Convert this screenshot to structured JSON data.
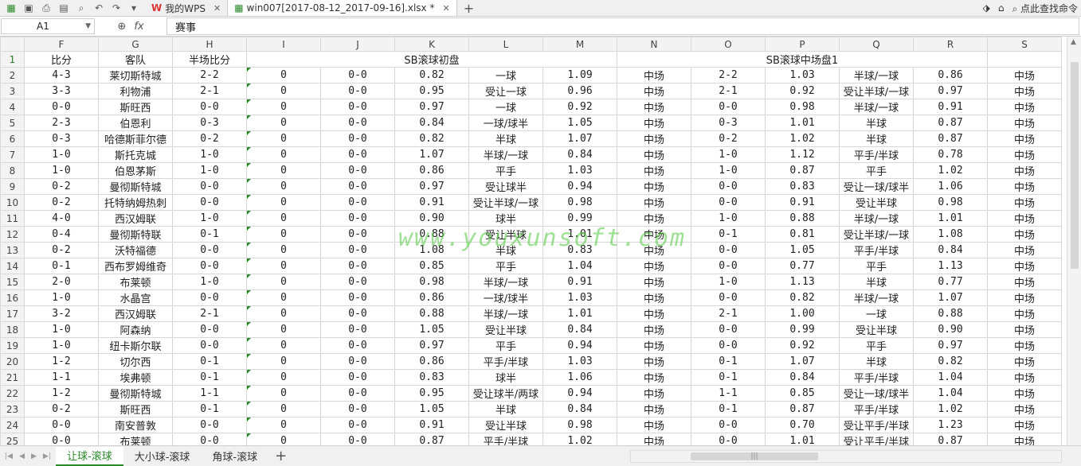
{
  "titlebar": {
    "tabs": [
      {
        "label": "我的WPS"
      },
      {
        "label": "win007[2017-08-12_2017-09-16].xlsx *"
      }
    ],
    "search_label": "点此查找命令"
  },
  "formula": {
    "cell_ref": "A1",
    "fx": "fx",
    "content": "赛事"
  },
  "columns": [
    "F",
    "G",
    "H",
    "I",
    "J",
    "K",
    "L",
    "M",
    "N",
    "O",
    "P",
    "Q",
    "R",
    "S"
  ],
  "header_row": {
    "num": "1",
    "f": "比分",
    "g": "客队",
    "h": "半场比分",
    "group1": "SB滚球初盘",
    "group2": "SB滚球中场盘1"
  },
  "rows": [
    {
      "n": "2",
      "f": "4-3",
      "g": "莱切斯特城",
      "h": "2-2",
      "i": "0",
      "j": "0-0",
      "k": "0.82",
      "l": "一球",
      "m": "1.09",
      "nn": "中场",
      "o": "2-2",
      "p": "1.03",
      "q": "半球/一球",
      "r": "0.86",
      "s": "中场"
    },
    {
      "n": "3",
      "f": "3-3",
      "g": "利物浦",
      "h": "2-1",
      "i": "0",
      "j": "0-0",
      "k": "0.95",
      "l": "受让一球",
      "m": "0.96",
      "nn": "中场",
      "o": "2-1",
      "p": "0.92",
      "q": "受让半球/一球",
      "r": "0.97",
      "s": "中场"
    },
    {
      "n": "4",
      "f": "0-0",
      "g": "斯旺西",
      "h": "0-0",
      "i": "0",
      "j": "0-0",
      "k": "0.97",
      "l": "一球",
      "m": "0.92",
      "nn": "中场",
      "o": "0-0",
      "p": "0.98",
      "q": "半球/一球",
      "r": "0.91",
      "s": "中场"
    },
    {
      "n": "5",
      "f": "2-3",
      "g": "伯恩利",
      "h": "0-3",
      "i": "0",
      "j": "0-0",
      "k": "0.84",
      "l": "一球/球半",
      "m": "1.05",
      "nn": "中场",
      "o": "0-3",
      "p": "1.01",
      "q": "半球",
      "r": "0.87",
      "s": "中场"
    },
    {
      "n": "6",
      "f": "0-3",
      "g": "哈德斯菲尔德",
      "h": "0-2",
      "i": "0",
      "j": "0-0",
      "k": "0.82",
      "l": "半球",
      "m": "1.07",
      "nn": "中场",
      "o": "0-2",
      "p": "1.02",
      "q": "半球",
      "r": "0.87",
      "s": "中场"
    },
    {
      "n": "7",
      "f": "1-0",
      "g": "斯托克城",
      "h": "1-0",
      "i": "0",
      "j": "0-0",
      "k": "1.07",
      "l": "半球/一球",
      "m": "0.84",
      "nn": "中场",
      "o": "1-0",
      "p": "1.12",
      "q": "平手/半球",
      "r": "0.78",
      "s": "中场"
    },
    {
      "n": "8",
      "f": "1-0",
      "g": "伯恩茅斯",
      "h": "1-0",
      "i": "0",
      "j": "0-0",
      "k": "0.86",
      "l": "平手",
      "m": "1.03",
      "nn": "中场",
      "o": "1-0",
      "p": "0.87",
      "q": "平手",
      "r": "1.02",
      "s": "中场"
    },
    {
      "n": "9",
      "f": "0-2",
      "g": "曼彻斯特城",
      "h": "0-0",
      "i": "0",
      "j": "0-0",
      "k": "0.97",
      "l": "受让球半",
      "m": "0.94",
      "nn": "中场",
      "o": "0-0",
      "p": "0.83",
      "q": "受让一球/球半",
      "r": "1.06",
      "s": "中场"
    },
    {
      "n": "10",
      "f": "0-2",
      "g": "托特纳姆热刺",
      "h": "0-0",
      "i": "0",
      "j": "0-0",
      "k": "0.91",
      "l": "受让半球/一球",
      "m": "0.98",
      "nn": "中场",
      "o": "0-0",
      "p": "0.91",
      "q": "受让半球",
      "r": "0.98",
      "s": "中场"
    },
    {
      "n": "11",
      "f": "4-0",
      "g": "西汉姆联",
      "h": "1-0",
      "i": "0",
      "j": "0-0",
      "k": "0.90",
      "l": "球半",
      "m": "0.99",
      "nn": "中场",
      "o": "1-0",
      "p": "0.88",
      "q": "半球/一球",
      "r": "1.01",
      "s": "中场"
    },
    {
      "n": "12",
      "f": "0-4",
      "g": "曼彻斯特联",
      "h": "0-1",
      "i": "0",
      "j": "0-0",
      "k": "0.88",
      "l": "受让半球",
      "m": "1.01",
      "nn": "中场",
      "o": "0-1",
      "p": "0.81",
      "q": "受让半球/一球",
      "r": "1.08",
      "s": "中场"
    },
    {
      "n": "13",
      "f": "0-2",
      "g": "沃特福德",
      "h": "0-0",
      "i": "0",
      "j": "0-0",
      "k": "1.08",
      "l": "半球",
      "m": "0.83",
      "nn": "中场",
      "o": "0-0",
      "p": "1.05",
      "q": "平手/半球",
      "r": "0.84",
      "s": "中场"
    },
    {
      "n": "14",
      "f": "0-1",
      "g": "西布罗姆维奇",
      "h": "0-0",
      "i": "0",
      "j": "0-0",
      "k": "0.85",
      "l": "平手",
      "m": "1.04",
      "nn": "中场",
      "o": "0-0",
      "p": "0.77",
      "q": "平手",
      "r": "1.13",
      "s": "中场"
    },
    {
      "n": "15",
      "f": "2-0",
      "g": "布莱顿",
      "h": "1-0",
      "i": "0",
      "j": "0-0",
      "k": "0.98",
      "l": "半球/一球",
      "m": "0.91",
      "nn": "中场",
      "o": "1-0",
      "p": "1.13",
      "q": "半球",
      "r": "0.77",
      "s": "中场"
    },
    {
      "n": "16",
      "f": "1-0",
      "g": "水晶宫",
      "h": "0-0",
      "i": "0",
      "j": "0-0",
      "k": "0.86",
      "l": "一球/球半",
      "m": "1.03",
      "nn": "中场",
      "o": "0-0",
      "p": "0.82",
      "q": "半球/一球",
      "r": "1.07",
      "s": "中场"
    },
    {
      "n": "17",
      "f": "3-2",
      "g": "西汉姆联",
      "h": "2-1",
      "i": "0",
      "j": "0-0",
      "k": "0.88",
      "l": "半球/一球",
      "m": "1.01",
      "nn": "中场",
      "o": "2-1",
      "p": "1.00",
      "q": "一球",
      "r": "0.88",
      "s": "中场"
    },
    {
      "n": "18",
      "f": "1-0",
      "g": "阿森纳",
      "h": "0-0",
      "i": "0",
      "j": "0-0",
      "k": "1.05",
      "l": "受让半球",
      "m": "0.84",
      "nn": "中场",
      "o": "0-0",
      "p": "0.99",
      "q": "受让半球",
      "r": "0.90",
      "s": "中场"
    },
    {
      "n": "19",
      "f": "1-0",
      "g": "纽卡斯尔联",
      "h": "0-0",
      "i": "0",
      "j": "0-0",
      "k": "0.97",
      "l": "平手",
      "m": "0.94",
      "nn": "中场",
      "o": "0-0",
      "p": "0.92",
      "q": "平手",
      "r": "0.97",
      "s": "中场"
    },
    {
      "n": "20",
      "f": "1-2",
      "g": "切尔西",
      "h": "0-1",
      "i": "0",
      "j": "0-0",
      "k": "0.86",
      "l": "平手/半球",
      "m": "1.03",
      "nn": "中场",
      "o": "0-1",
      "p": "1.07",
      "q": "半球",
      "r": "0.82",
      "s": "中场"
    },
    {
      "n": "21",
      "f": "1-1",
      "g": "埃弗顿",
      "h": "0-1",
      "i": "0",
      "j": "0-0",
      "k": "0.83",
      "l": "球半",
      "m": "1.06",
      "nn": "中场",
      "o": "0-1",
      "p": "0.84",
      "q": "平手/半球",
      "r": "1.04",
      "s": "中场"
    },
    {
      "n": "22",
      "f": "1-2",
      "g": "曼彻斯特城",
      "h": "1-1",
      "i": "0",
      "j": "0-0",
      "k": "0.95",
      "l": "受让球半/两球",
      "m": "0.94",
      "nn": "中场",
      "o": "1-1",
      "p": "0.85",
      "q": "受让一球/球半",
      "r": "1.04",
      "s": "中场"
    },
    {
      "n": "23",
      "f": "0-2",
      "g": "斯旺西",
      "h": "0-1",
      "i": "0",
      "j": "0-0",
      "k": "1.05",
      "l": "半球",
      "m": "0.84",
      "nn": "中场",
      "o": "0-1",
      "p": "0.87",
      "q": "平手/半球",
      "r": "1.02",
      "s": "中场"
    },
    {
      "n": "24",
      "f": "0-0",
      "g": "南安普敦",
      "h": "0-0",
      "i": "0",
      "j": "0-0",
      "k": "0.91",
      "l": "受让半球",
      "m": "0.98",
      "nn": "中场",
      "o": "0-0",
      "p": "0.70",
      "q": "受让平手/半球",
      "r": "1.23",
      "s": "中场"
    },
    {
      "n": "25",
      "f": "0-0",
      "g": "布莱顿",
      "h": "0-0",
      "i": "0",
      "j": "0-0",
      "k": "0.87",
      "l": "平手/半球",
      "m": "1.02",
      "nn": "中场",
      "o": "0-0",
      "p": "1.01",
      "q": "受让平手/半球",
      "r": "0.87",
      "s": "中场"
    }
  ],
  "sheet_tabs": [
    {
      "label": "让球-滚球"
    },
    {
      "label": "大小球-滚球"
    },
    {
      "label": "角球-滚球"
    }
  ],
  "watermark": "www.youxunsoft.com",
  "colors": {
    "accent": "#2a8a2a"
  }
}
